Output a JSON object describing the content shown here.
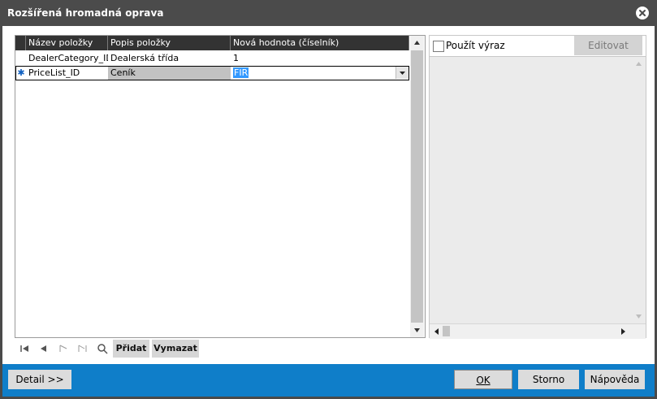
{
  "window": {
    "title": "Rozšířená hromadná oprava"
  },
  "grid": {
    "columns": [
      "Název položky",
      "Popis položky",
      "Nová hodnota (číselník)"
    ],
    "rows": [
      {
        "indicator": "",
        "name": "DealerCategory_ID",
        "description": "Dealerská třída",
        "value": "1"
      },
      {
        "indicator": "✱",
        "name": "PriceList_ID",
        "description": "Ceník",
        "value": "FIR"
      }
    ]
  },
  "navigator": {
    "add_label": "Přidat",
    "delete_label": "Vymazat"
  },
  "expression": {
    "use_expression_label": "Použít výraz",
    "use_expression_checked": false,
    "edit_label": "Editovat"
  },
  "footer": {
    "detail_label": "Detail >>",
    "ok_label": "OK",
    "cancel_label": "Storno",
    "help_label": "Nápověda"
  },
  "colors": {
    "title_bar": "#4b4b4b",
    "footer_bar": "#0f7ec9",
    "grid_header": "#333333",
    "selection": "#3399ff"
  }
}
